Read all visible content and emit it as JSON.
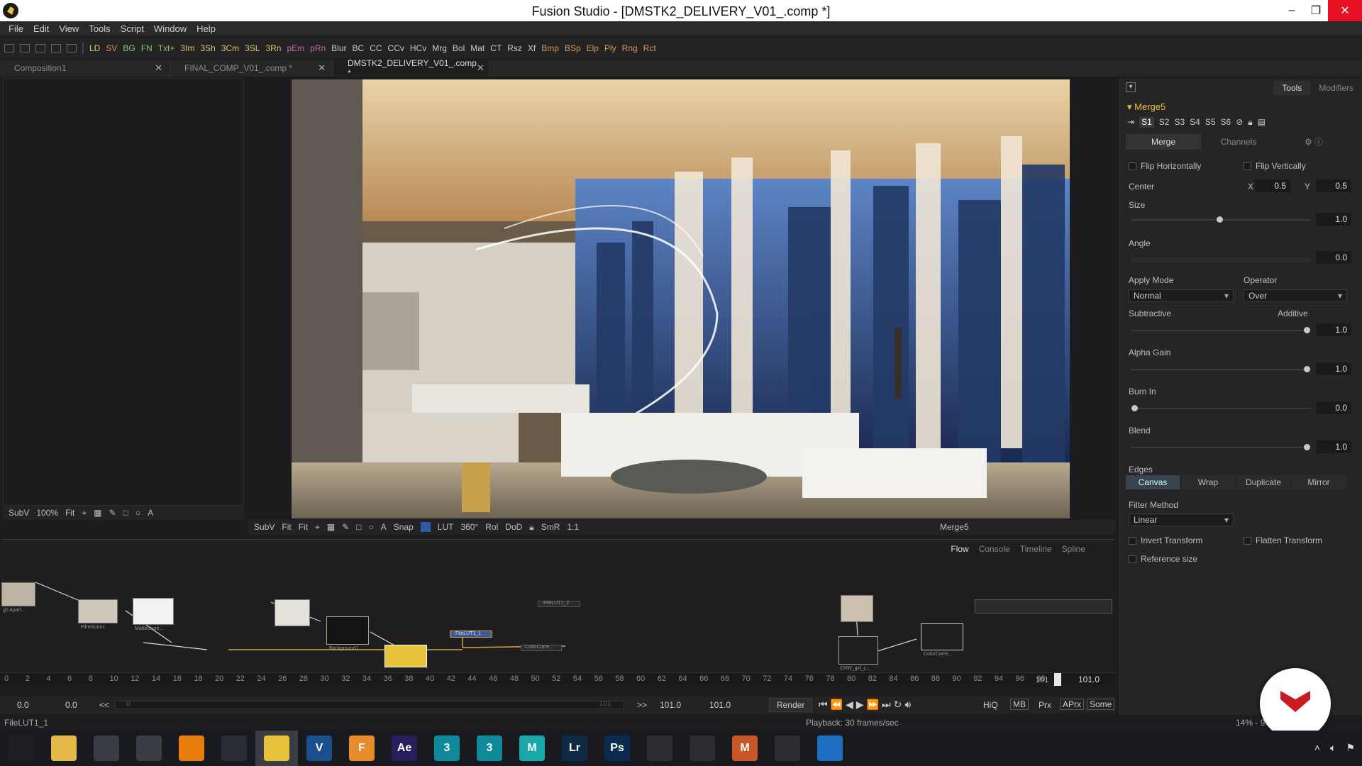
{
  "window": {
    "title": "Fusion Studio - [DMSTK2_DELIVERY_V01_.comp *]"
  },
  "menu": [
    "File",
    "Edit",
    "View",
    "Tools",
    "Script",
    "Window",
    "Help"
  ],
  "toolbar": [
    "LD",
    "SV",
    "BG",
    "FN",
    "Txt+",
    "3Im",
    "3Sh",
    "3Cm",
    "3SL",
    "3Rn",
    "pEm",
    "pRn",
    "Blur",
    "BC",
    "CC",
    "CCv",
    "HCv",
    "Mrg",
    "Bol",
    "Mat",
    "CT",
    "Rsz",
    "Xf",
    "Bmp",
    "BSp",
    "Elp",
    "Ply",
    "Rng",
    "Rct"
  ],
  "tabs": [
    {
      "label": "Composition1"
    },
    {
      "label": "FINAL_COMP_V01_.comp *"
    },
    {
      "label": "DMSTK2_DELIVERY_V01_.comp *"
    }
  ],
  "left_viewer_bar": {
    "subv": "SubV",
    "zoom": "100%",
    "fit": "Fit"
  },
  "main_viewer_bar": {
    "subv": "SubV",
    "fit": "Fit",
    "fit2": "Fit",
    "snap": "Snap",
    "lut": "LUT",
    "deg": "360°",
    "rol": "Rol",
    "dod": "DoD",
    "smr": "SmR",
    "ratio": "1:1",
    "node": "Merge5"
  },
  "panel": {
    "tab_tools": "Tools",
    "tab_modifiers": "Modifiers",
    "node_name": "Merge5",
    "slots": [
      "S1",
      "S2",
      "S3",
      "S4",
      "S5",
      "S6"
    ],
    "subtab_merge": "Merge",
    "subtab_channels": "Channels",
    "flip_h": "Flip Horizontally",
    "flip_v": "Flip Vertically",
    "center": "Center",
    "x_label": "X",
    "x_val": "0.5",
    "y_label": "Y",
    "y_val": "0.5",
    "size": "Size",
    "size_val": "1.0",
    "angle": "Angle",
    "angle_val": "0.0",
    "apply_mode": "Apply Mode",
    "apply_mode_val": "Normal",
    "operator": "Operator",
    "operator_val": "Over",
    "subtractive": "Subtractive",
    "additive": "Additive",
    "add_val": "1.0",
    "alpha_gain": "Alpha Gain",
    "alpha_val": "1.0",
    "burn_in": "Burn In",
    "burn_val": "0.0",
    "blend": "Blend",
    "blend_val": "1.0",
    "edges": "Edges",
    "edge_canvas": "Canvas",
    "edge_wrap": "Wrap",
    "edge_duplicate": "Duplicate",
    "edge_mirror": "Mirror",
    "filter_method": "Filter Method",
    "filter_val": "Linear",
    "invert_transform": "Invert Transform",
    "flatten_transform": "Flatten Transform",
    "reference_size": "Reference size"
  },
  "flow": {
    "tabs": [
      "Flow",
      "Console",
      "Timeline",
      "Spline"
    ],
    "node_labels": [
      "gh Apart...",
      "FilmGrain1",
      "MatteContr...",
      "Background1",
      "FileLUT1_1",
      "FileLUT1_2",
      "ColorCorre...",
      "ColorCorre...",
      "CHW_girl_c..."
    ]
  },
  "timeline": {
    "marker": "101",
    "end": "101.0",
    "ticks": [
      "0",
      "2",
      "4",
      "6",
      "8",
      "10",
      "12",
      "14",
      "16",
      "18",
      "20",
      "22",
      "24",
      "26",
      "28",
      "30",
      "32",
      "34",
      "36",
      "38",
      "40",
      "42",
      "44",
      "46",
      "48",
      "50",
      "52",
      "54",
      "56",
      "58",
      "60",
      "62",
      "64",
      "66",
      "68",
      "70",
      "72",
      "74",
      "76",
      "78",
      "80",
      "82",
      "84",
      "86",
      "88",
      "90",
      "92",
      "94",
      "96",
      "98"
    ]
  },
  "transport": {
    "start": "0.0",
    "current": "0.0",
    "back": "<<",
    "range_start": "0",
    "range_end": "101",
    "fwd": ">>",
    "end1": "101.0",
    "end2": "101.0",
    "render": "Render",
    "hiq": "HiQ",
    "mb": "MB",
    "prx": "Prx",
    "aprx": "APrx",
    "some": "Some"
  },
  "status": {
    "left": "FileLUT1_1",
    "center": "Playback: 30 frames/sec",
    "right": "14% - 9..."
  },
  "taskbar": [
    {
      "name": "windows-start-icon",
      "label": "",
      "color": "#1d1f24"
    },
    {
      "name": "file-explorer-icon",
      "label": "",
      "color": "#e6b84a"
    },
    {
      "name": "satellite-app-icon",
      "label": "",
      "color": "#3a3d44"
    },
    {
      "name": "davinci-film-icon",
      "label": "",
      "color": "#3a3d44"
    },
    {
      "name": "blender-icon",
      "label": "",
      "color": "#e87d0d"
    },
    {
      "name": "davinci-resolve-icon",
      "label": "",
      "color": "#2a2d33"
    },
    {
      "name": "fusion-icon",
      "label": "",
      "color": "#e8c23a"
    },
    {
      "name": "vray-icon",
      "label": "V",
      "color": "#1b4e8c"
    },
    {
      "name": "forest-pack-icon",
      "label": "F",
      "color": "#e88b2c"
    },
    {
      "name": "after-effects-icon",
      "label": "Ae",
      "color": "#2a1d5c"
    },
    {
      "name": "3dsmax-icon-1",
      "label": "3",
      "color": "#0f8a9a"
    },
    {
      "name": "3dsmax-icon-2",
      "label": "3",
      "color": "#0f8a9a"
    },
    {
      "name": "maya-icon",
      "label": "M",
      "color": "#1aa7a8"
    },
    {
      "name": "lightroom-icon",
      "label": "Lr",
      "color": "#0f2a44"
    },
    {
      "name": "photoshop-icon",
      "label": "Ps",
      "color": "#0a2a4e"
    },
    {
      "name": "chrome-icon",
      "label": "",
      "color": "#2b2d33"
    },
    {
      "name": "record-icon",
      "label": "",
      "color": "#2b2d33"
    },
    {
      "name": "mudbox-icon",
      "label": "M",
      "color": "#c8572a"
    },
    {
      "name": "rhino-icon",
      "label": "",
      "color": "#2b2d33"
    },
    {
      "name": "quicktime-icon",
      "label": "",
      "color": "#1c6fc4"
    }
  ]
}
